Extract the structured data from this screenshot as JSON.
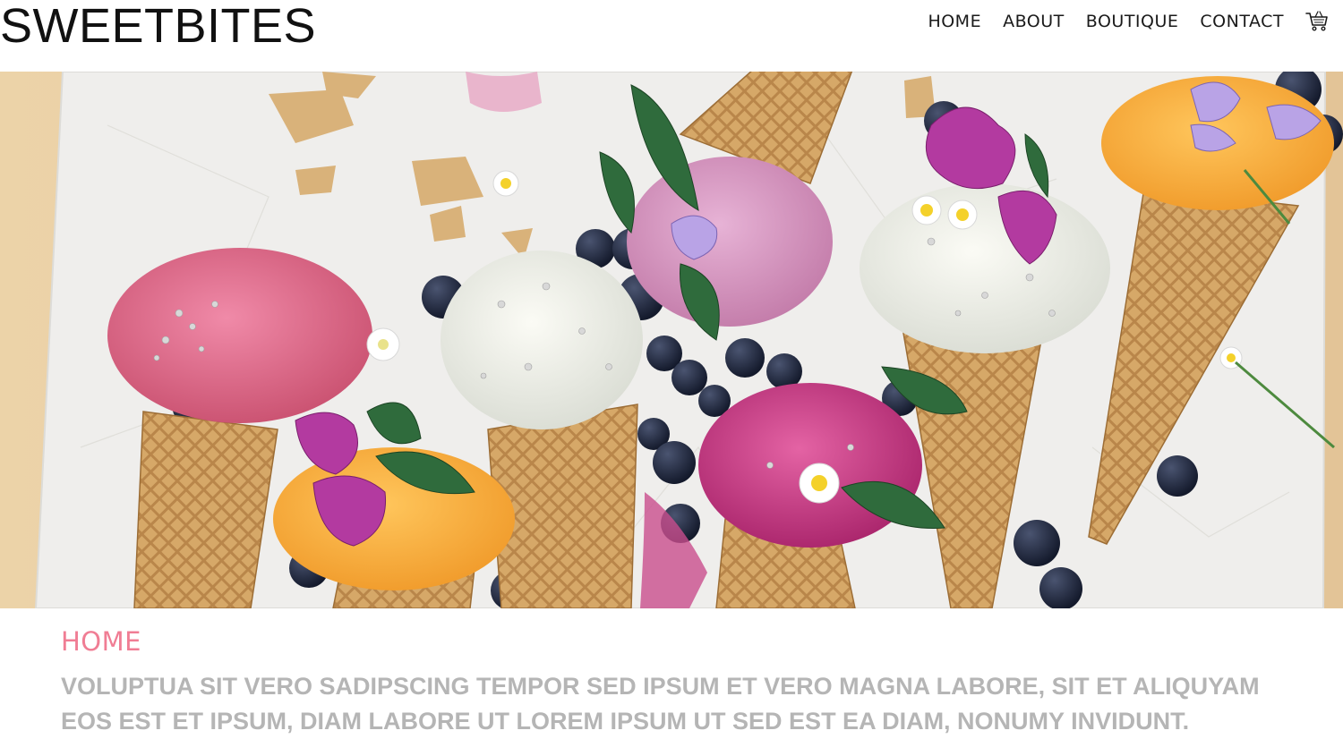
{
  "brand": {
    "logo_text": "SWEETBITES"
  },
  "nav": {
    "items": [
      {
        "label": "Home"
      },
      {
        "label": "About"
      },
      {
        "label": "Boutique"
      },
      {
        "label": "Contact"
      }
    ],
    "cart_icon": "shopping-cart-icon"
  },
  "hero": {
    "image_subject": "ice cream cones with berries and flowers"
  },
  "section": {
    "title": "Home",
    "body": "Voluptua sit vero sadipscing tempor sed ipsum et vero magna labore, sit et aliquyam eos est et ipsum, diam labore ut lorem ipsum ut sed est ea diam, nonumy invidunt."
  },
  "colors": {
    "accent": "#f07d94",
    "body_text": "#b5b5b5",
    "nav_text": "#1a1a1a"
  }
}
